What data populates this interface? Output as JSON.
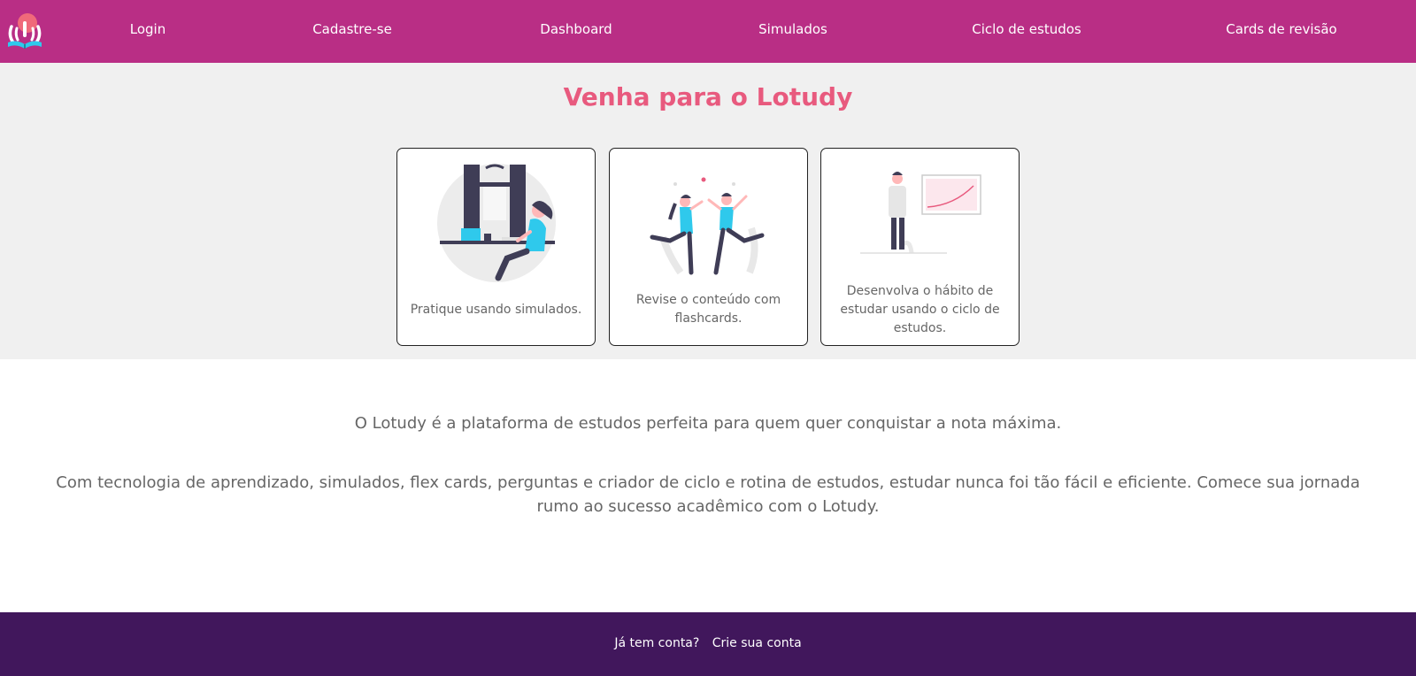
{
  "nav": {
    "logo_icon": "lotudy-book-logo-icon",
    "items": [
      {
        "label": "Login"
      },
      {
        "label": "Cadastre-se"
      },
      {
        "label": "Dashboard"
      },
      {
        "label": "Simulados"
      },
      {
        "label": "Ciclo de estudos"
      },
      {
        "label": "Cards de revisão"
      }
    ]
  },
  "hero": {
    "title": "Venha para o Lotudy",
    "cards": [
      {
        "illustration": "person-at-desk-illustration",
        "text": "Pratique usando simulados."
      },
      {
        "illustration": "high-five-illustration",
        "text": "Revise o conteúdo com flashcards."
      },
      {
        "illustration": "person-with-chart-illustration",
        "text": "Desenvolva o hábito de estudar usando o ciclo de estudos."
      }
    ]
  },
  "about": {
    "paragraph1": "O Lotudy é a plataforma de estudos perfeita para quem quer conquistar a nota máxima.",
    "paragraph2": "Com tecnologia de aprendizado, simulados, flex cards, perguntas e criador de ciclo e rotina de estudos, estudar nunca foi tão fácil e eficiente. Comece sua jornada rumo ao sucesso acadêmico com o Lotudy."
  },
  "footer": {
    "question": "Já tem conta?",
    "link": "Crie sua conta"
  },
  "colors": {
    "navbar": "#b92e85",
    "title_accent": "#e85a7e",
    "footer": "#41175c",
    "hero_bg": "#f0f0f0",
    "illustration_cyan": "#2fc9ec"
  }
}
